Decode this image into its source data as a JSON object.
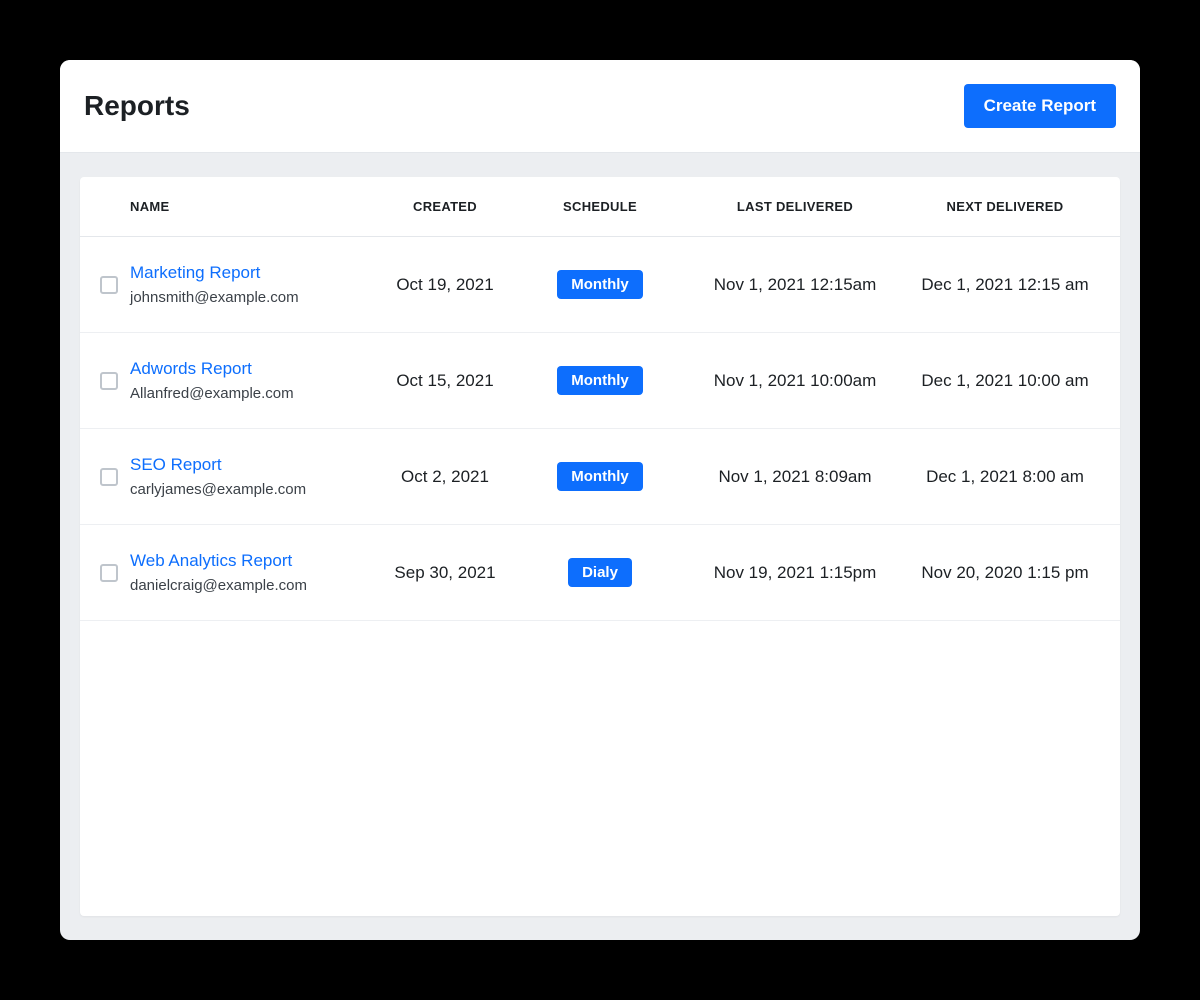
{
  "header": {
    "title": "Reports",
    "create_button": "Create Report"
  },
  "table": {
    "columns": {
      "name": "NAME",
      "created": "CREATED",
      "schedule": "SCHEDULE",
      "last_delivered": "LAST DELIVERED",
      "next_delivered": "NEXT DELIVERED"
    },
    "rows": [
      {
        "name": "Marketing Report",
        "email": "johnsmith@example.com",
        "created": "Oct 19, 2021",
        "schedule": "Monthly",
        "last_delivered": "Nov 1, 2021 12:15am",
        "next_delivered": "Dec 1, 2021 12:15 am"
      },
      {
        "name": "Adwords Report",
        "email": "Allanfred@example.com",
        "created": "Oct 15, 2021",
        "schedule": "Monthly",
        "last_delivered": "Nov 1, 2021 10:00am",
        "next_delivered": "Dec 1, 2021 10:00 am"
      },
      {
        "name": "SEO Report",
        "email": "carlyjames@example.com",
        "created": "Oct 2, 2021",
        "schedule": "Monthly",
        "last_delivered": "Nov 1, 2021 8:09am",
        "next_delivered": "Dec 1, 2021 8:00 am"
      },
      {
        "name": "Web Analytics Report",
        "email": "danielcraig@example.com",
        "created": "Sep 30, 2021",
        "schedule": "Dialy",
        "last_delivered": "Nov 19, 2021 1:15pm",
        "next_delivered": "Nov 20, 2020 1:15 pm"
      }
    ]
  },
  "colors": {
    "primary": "#0d6efd",
    "surface": "#ffffff",
    "backdrop": "#eceef1",
    "text": "#1c2024"
  }
}
